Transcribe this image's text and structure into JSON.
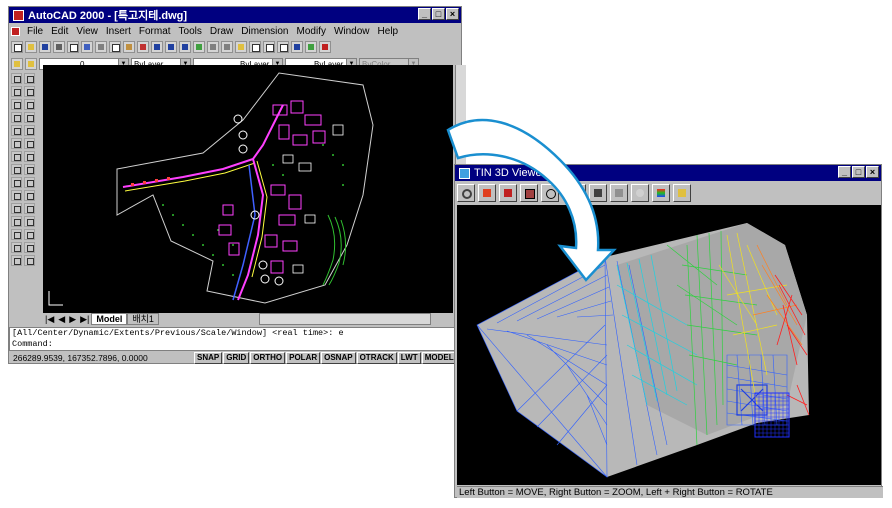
{
  "autocad": {
    "title": "AutoCAD 2000 - [특고지테.dwg]",
    "menu": [
      "File",
      "Edit",
      "View",
      "Insert",
      "Format",
      "Tools",
      "Draw",
      "Dimension",
      "Modify",
      "Window",
      "Help"
    ],
    "layer_combo": "0",
    "color_combo": "ByLayer",
    "linetype_combo": "ByLayer",
    "lineweight_combo": "ByLayer",
    "plotstyle_combo": "ByColor",
    "tabs": {
      "model": "Model",
      "layout": "배치1"
    },
    "command_line_1": "[All/Center/Dynamic/Extents/Previous/Scale/Window] <real time>: e",
    "command_line_2": "Command:",
    "coordinates": "266289.9539, 167352.7896, 0.0000",
    "status_buttons": [
      "SNAP",
      "GRID",
      "ORTHO",
      "POLAR",
      "OSNAP",
      "OTRACK",
      "LWT",
      "MODEL"
    ]
  },
  "tin": {
    "title": "TIN 3D Viewer",
    "status": "Left Button = MOVE,   Right Button = ZOOM,    Left + Right Button = ROTATE",
    "tool_icons": [
      "zoom-extents-icon",
      "box-icon",
      "cube-red-icon",
      "cube-select-icon",
      "sphere-icon",
      "surface-icon",
      "mesh-icon",
      "shade-icon",
      "sphere-shade-icon",
      "color-ramp-icon",
      "export-icon"
    ]
  },
  "colors": {
    "titlebar": "#000080",
    "arrow": "#1a8fd0",
    "face": "#c0c0c0"
  }
}
